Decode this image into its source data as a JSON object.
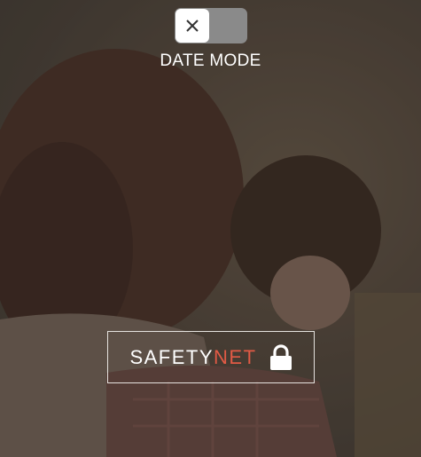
{
  "toggle": {
    "state": "off",
    "knob_icon": "close-icon",
    "label": "DATE MODE"
  },
  "safetynet_button": {
    "brand_prefix": "SAFETY",
    "brand_suffix": "NET",
    "icon": "lock-icon"
  },
  "colors": {
    "accent": "#e25a45",
    "text": "#ffffff",
    "toggle_track": "#8a8a8a",
    "overlay": "#28242059"
  }
}
